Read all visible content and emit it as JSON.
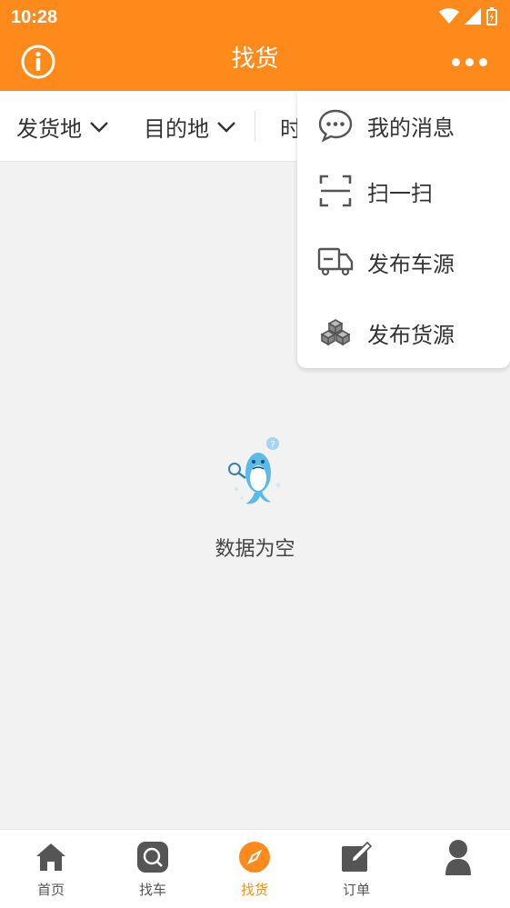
{
  "status_bar": {
    "time": "10:28"
  },
  "header": {
    "title": "找货",
    "info_icon": "info-icon",
    "more_icon": "more-dots-icon",
    "accent": "#ff8a1c"
  },
  "filters": [
    {
      "label": "发货地"
    },
    {
      "label": "目的地"
    },
    {
      "label": "时"
    }
  ],
  "empty_state": {
    "text": "数据为空"
  },
  "menu": {
    "items": [
      {
        "label": "我的消息",
        "icon": "chat-bubble-icon"
      },
      {
        "label": "扫一扫",
        "icon": "scan-icon"
      },
      {
        "label": "发布车源",
        "icon": "truck-icon"
      },
      {
        "label": "发布货源",
        "icon": "boxes-icon"
      }
    ]
  },
  "tabbar": {
    "active_color": "#ff8a1c",
    "items": [
      {
        "label": "首页",
        "icon": "home-icon"
      },
      {
        "label": "找车",
        "icon": "search-car-icon"
      },
      {
        "label": "找货",
        "icon": "compass-icon",
        "active": true
      },
      {
        "label": "订单",
        "icon": "edit-order-icon"
      },
      {
        "label": "",
        "icon": "user-icon"
      }
    ]
  }
}
